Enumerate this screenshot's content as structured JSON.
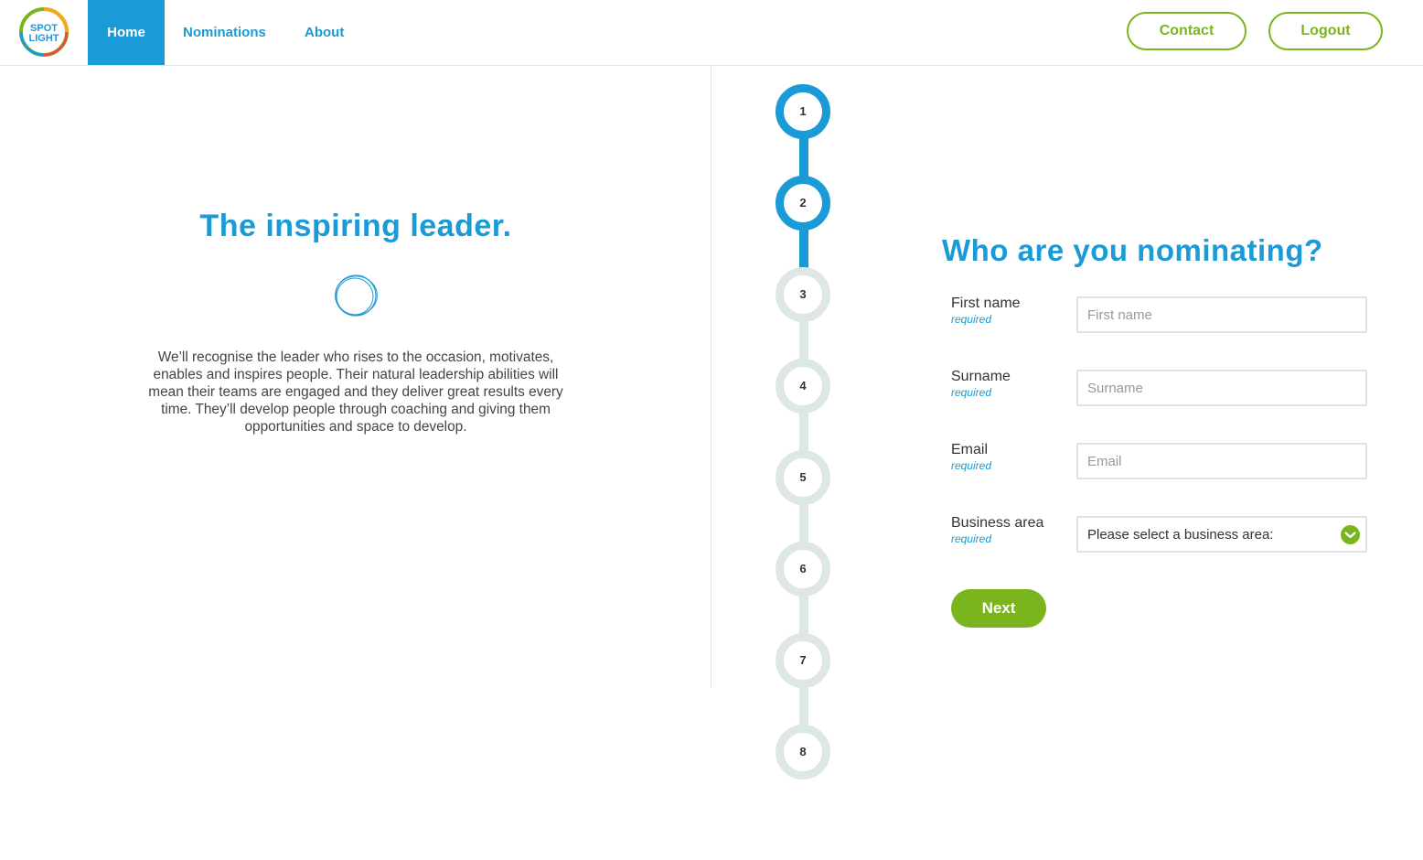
{
  "header": {
    "logo_text_top": "SPOT",
    "logo_text_bottom": "LIGHT",
    "nav": {
      "home": "Home",
      "nominations": "Nominations",
      "about": "About"
    },
    "contact_label": "Contact",
    "logout_label": "Logout"
  },
  "intro": {
    "title": "The inspiring leader.",
    "description": "We’ll recognise the leader who rises to the occasion, motivates, enables and inspires people. Their natural leadership abilities will mean their teams are engaged and they deliver great results every time. They’ll develop people through coaching and giving them opportunities and space to develop."
  },
  "stepper": {
    "steps": [
      "1",
      "2",
      "3",
      "4",
      "5",
      "6",
      "7",
      "8"
    ],
    "current_step": 2
  },
  "form": {
    "title": "Who are you nominating?",
    "required_text": "required",
    "first_name": {
      "label": "First name",
      "placeholder": "First name"
    },
    "surname": {
      "label": "Surname",
      "placeholder": "Surname"
    },
    "email": {
      "label": "Email",
      "placeholder": "Email"
    },
    "business_area": {
      "label": "Business area",
      "selected": "Please select a business area:"
    },
    "next_label": "Next"
  },
  "colors": {
    "brand_blue": "#1a9ad6",
    "brand_green": "#7ab51d",
    "inactive_step": "#dde8e6"
  },
  "icons": {
    "logo": "spotlight-logo-icon",
    "decorative": "circle-doodle-icon",
    "select": "chevron-down-icon"
  }
}
